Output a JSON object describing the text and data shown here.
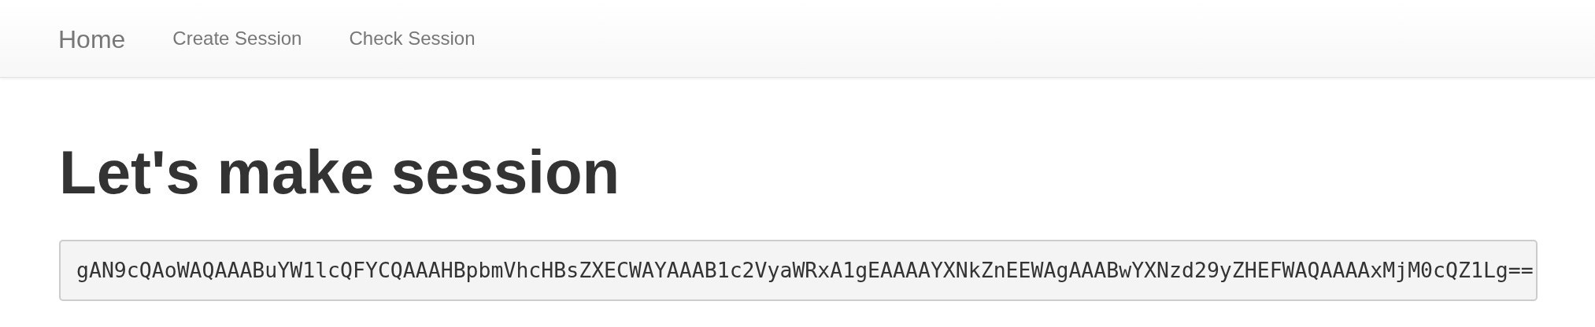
{
  "navbar": {
    "brand": "Home",
    "links": [
      {
        "label": "Create Session"
      },
      {
        "label": "Check Session"
      }
    ]
  },
  "heading": "Let's make session",
  "session_code": "gAN9cQAoWAQAAABuYW1lcQFYCQAAAHBpbmVhcHBsZXECWAYAAAB1c2VyaWRxA1gEAAAAYXNkZnEEWAgAAABwYXNzd29yZHEFWAQAAAAxMjM0cQZ1Lg=="
}
